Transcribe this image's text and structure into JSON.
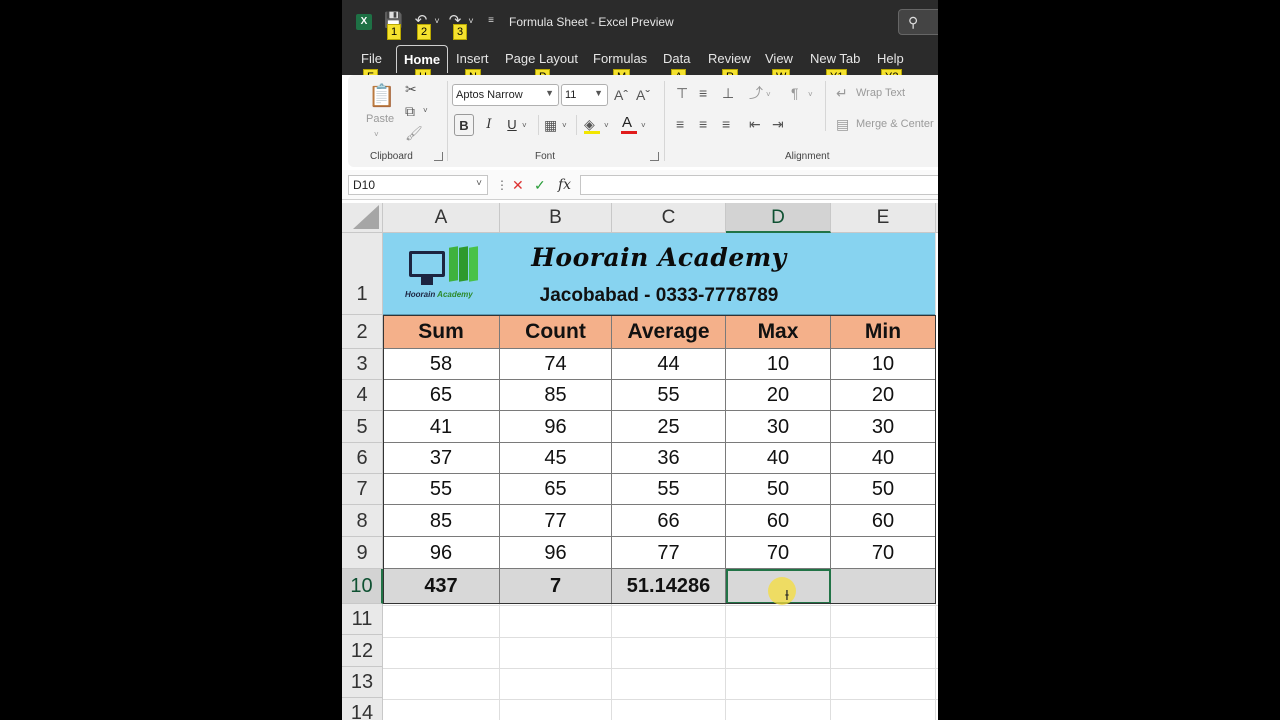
{
  "window": {
    "title": "Formula Sheet  -  Excel Preview",
    "app_logo": "X"
  },
  "quick_access": {
    "save_keytip": "1",
    "undo_keytip": "2",
    "redo_keytip": "3"
  },
  "tabs": [
    {
      "label": "File",
      "keytip": "F"
    },
    {
      "label": "Home",
      "keytip": "H"
    },
    {
      "label": "Insert",
      "keytip": "N"
    },
    {
      "label": "Page Layout",
      "keytip": "P"
    },
    {
      "label": "Formulas",
      "keytip": "M"
    },
    {
      "label": "Data",
      "keytip": "A"
    },
    {
      "label": "Review",
      "keytip": "R"
    },
    {
      "label": "View",
      "keytip": "W"
    },
    {
      "label": "New Tab",
      "keytip": "Y1"
    },
    {
      "label": "Help",
      "keytip": "Y2"
    }
  ],
  "ribbon": {
    "clipboard": {
      "paste_label": "Paste",
      "group_label": "Clipboard"
    },
    "font": {
      "font_name": "Aptos Narrow",
      "font_size": "11",
      "group_label": "Font",
      "bold": "B",
      "italic": "I",
      "underline": "U"
    },
    "alignment": {
      "wrap_text": "Wrap Text",
      "merge_center": "Merge & Center",
      "group_label": "Alignment"
    }
  },
  "formula_bar": {
    "name_box": "D10",
    "fx_label": "fx",
    "formula": ""
  },
  "columns": [
    "A",
    "B",
    "C",
    "D",
    "E"
  ],
  "selected_column": "D",
  "rows": [
    "1",
    "2",
    "3",
    "4",
    "5",
    "6",
    "7",
    "8",
    "9",
    "10",
    "11",
    "12",
    "13",
    "14"
  ],
  "selected_row": "10",
  "banner": {
    "title": "Hoorain Academy",
    "subtitle": "Jacobabad - 0333-7778789",
    "logo_text_1": "Hoorain",
    "logo_text_2": "Academy"
  },
  "table": {
    "headers": [
      "Sum",
      "Count",
      "Average",
      "Max",
      "Min"
    ],
    "body": [
      [
        "58",
        "74",
        "44",
        "10",
        "10"
      ],
      [
        "65",
        "85",
        "55",
        "20",
        "20"
      ],
      [
        "41",
        "96",
        "25",
        "30",
        "30"
      ],
      [
        "37",
        "45",
        "36",
        "40",
        "40"
      ],
      [
        "55",
        "65",
        "55",
        "50",
        "50"
      ],
      [
        "85",
        "77",
        "66",
        "60",
        "60"
      ],
      [
        "96",
        "96",
        "77",
        "70",
        "70"
      ]
    ],
    "totals": [
      "437",
      "7",
      "51.14286",
      "",
      ""
    ]
  },
  "colors": {
    "banner_bg": "#87d3f0",
    "header_bg": "#f4b08a",
    "total_bg": "#d8d8d8",
    "selection": "#217346",
    "keytip": "#f5e22e"
  }
}
